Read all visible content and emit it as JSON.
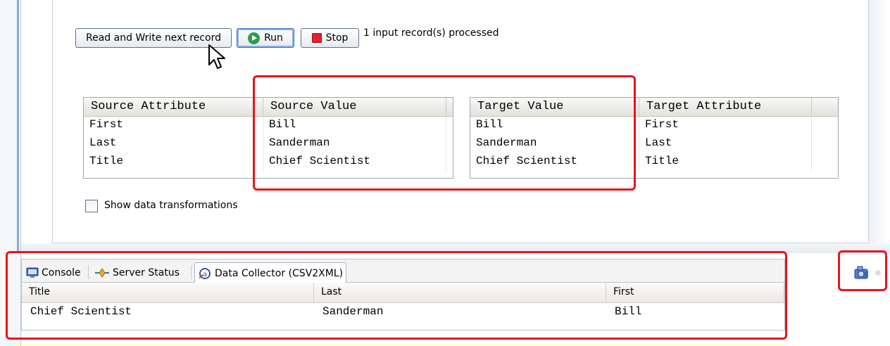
{
  "toolbar": {
    "read_write_label": "Read and Write next record",
    "run_label": "Run",
    "stop_label": "Stop",
    "status_text": "1 input record(s) processed"
  },
  "source_table": {
    "headers": [
      "Source Attribute",
      "Source Value"
    ],
    "rows": [
      [
        "First",
        "Bill"
      ],
      [
        "Last",
        "Sanderman"
      ],
      [
        "Title",
        "Chief Scientist"
      ]
    ]
  },
  "target_table": {
    "headers": [
      "Target Value",
      "Target Attribute"
    ],
    "rows": [
      [
        "Bill",
        "First"
      ],
      [
        "Sanderman",
        "Last"
      ],
      [
        "Chief Scientist",
        "Title"
      ]
    ]
  },
  "options": {
    "show_transformations_label": "Show data transformations",
    "show_transformations_checked": false
  },
  "views": {
    "tabs": [
      {
        "label": "Console",
        "icon": "console-icon",
        "active": false
      },
      {
        "label": "Server Status",
        "icon": "server-status-icon",
        "active": false
      },
      {
        "label": "Data Collector (CSV2XML)",
        "icon": "data-collector-icon",
        "active": true
      }
    ],
    "collector": {
      "headers": [
        "Title",
        "Last",
        "First"
      ],
      "rows": [
        [
          "Chief Scientist",
          "Sanderman",
          "Bill"
        ]
      ]
    },
    "toolbar_icon": "camera-icon"
  },
  "colors": {
    "highlight": "#e8141b",
    "run": "#2d9d4a",
    "stop": "#e02235"
  }
}
